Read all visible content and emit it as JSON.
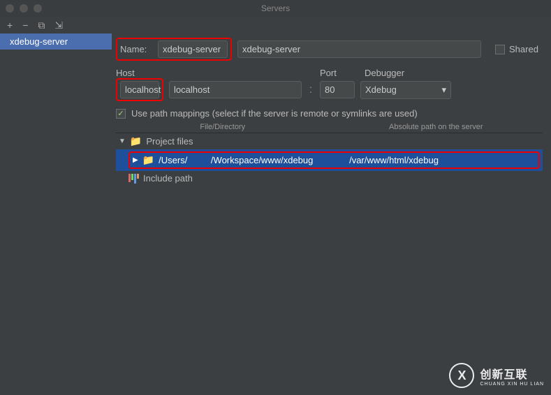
{
  "window": {
    "title": "Servers"
  },
  "toolbar": {
    "add": "+",
    "remove": "−",
    "copy": "⧉",
    "sort": "⇲"
  },
  "sidebar": {
    "items": [
      {
        "label": "xdebug-server"
      }
    ]
  },
  "form": {
    "name_label": "Name:",
    "name_value": "xdebug-server",
    "shared_label": "Shared",
    "host_label": "Host",
    "host_value": "localhost",
    "port_label": "Port",
    "port_value": "80",
    "debugger_label": "Debugger",
    "debugger_value": "Xdebug",
    "colon": ":",
    "use_path_mappings": "Use path mappings (select if the server is remote or symlinks are used)"
  },
  "table": {
    "col1": "File/Directory",
    "col2": "Absolute path on the server"
  },
  "tree": {
    "root": "Project files",
    "local_prefix": "/Users/",
    "local_suffix": " /Workspace/www/xdebug",
    "abs": "/var/www/html/xdebug",
    "include": "Include path"
  },
  "watermark": {
    "logo": "X",
    "text_main": "创新互联",
    "text_sub": "CHUANG XIN HU LIAN"
  }
}
